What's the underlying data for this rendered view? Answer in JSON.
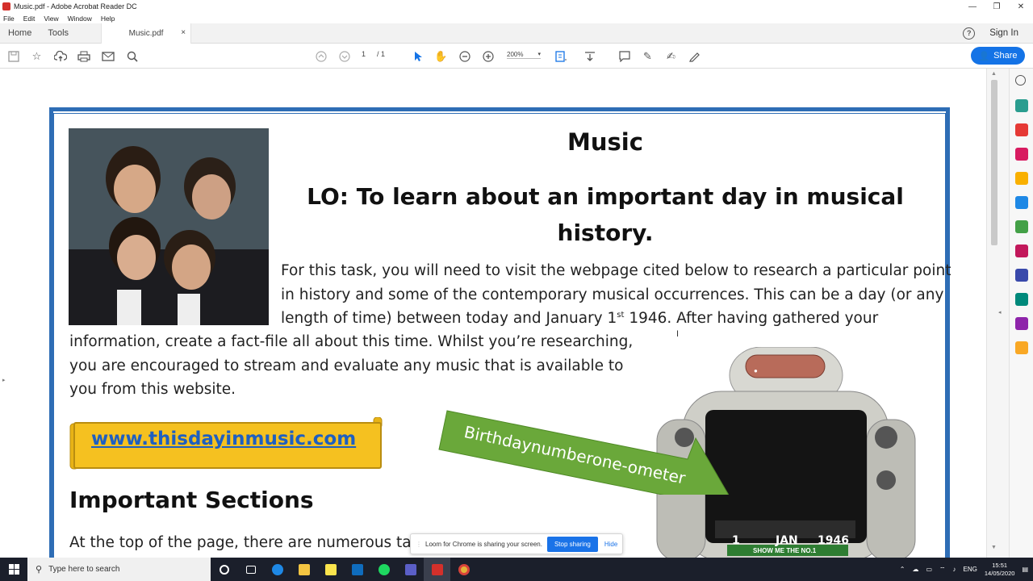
{
  "window": {
    "title": "Music.pdf - Adobe Acrobat Reader DC"
  },
  "menu": [
    "File",
    "Edit",
    "View",
    "Window",
    "Help"
  ],
  "tabs": {
    "home": "Home",
    "tools": "Tools",
    "document": "Music.pdf",
    "close": "×",
    "sign_in": "Sign In"
  },
  "toolbar": {
    "page_current": "1",
    "page_total": "/ 1",
    "zoom": "200%",
    "share_label": "Share"
  },
  "document": {
    "title": "Music",
    "lo": "LO: To learn about an important day in musical history.",
    "para_lines": [
      "For this task, you will need to visit the webpage cited below to research a particular point",
      "in history and some of the contemporary musical occurrences. This can be a day (or any",
      "length of time) between today and January 1",
      "information, create a fact-file all about this time. Whilst you’re researching,",
      "you are encouraged to stream and evaluate any music that is available to",
      "you from this website."
    ],
    "line3_sup": "st",
    "line3_rest": " 1946. After having gathered your",
    "link": "www.thisdayinmusic.com",
    "section_heading": "Important Sections",
    "section_text": "At the top of the page, there are numerous tabs",
    "arrow_label": "Birthdaynumberone-ometer",
    "jukebox": {
      "day": "1",
      "month": "JAN",
      "year": "1946",
      "button": "SHOW ME THE NO.1"
    }
  },
  "loom": {
    "message": "Loom for Chrome is sharing your screen.",
    "stop": "Stop sharing",
    "hide": "Hide"
  },
  "taskbar": {
    "search_placeholder": "Type here to search",
    "lang": "ENG",
    "time": "15:51",
    "date": "14/05/2020"
  },
  "colors": {
    "accent": "#1473e6",
    "frame": "#2e6db5",
    "banner": "#f5c120",
    "arrow": "#6aa83a"
  }
}
